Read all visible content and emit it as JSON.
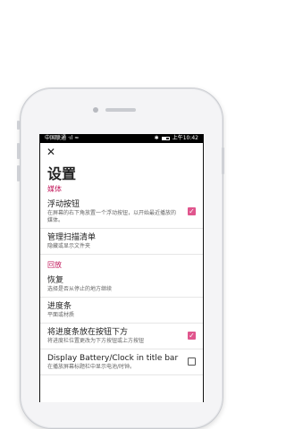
{
  "status_bar": {
    "carrier": "中国联通",
    "signal": "‧ıl",
    "wifi": "≈",
    "time": "上午10:42",
    "bt_icon": "bluetooth-icon"
  },
  "toolbar": {
    "close_glyph": "✕",
    "title": "设置"
  },
  "sections": {
    "media": "媒体",
    "resume": "回放"
  },
  "prefs": {
    "floating_button": {
      "title": "浮动按钮",
      "summary": "在屏幕的右下角放置一个浮动按钮，以开始最近播放的媒体。",
      "checked": true
    },
    "manage_scan": {
      "title": "管理扫描清单",
      "summary": "隐藏或显示文件夹"
    },
    "resume": {
      "title": "恢复",
      "summary": "选择是否从停止的地方继续"
    },
    "progress_bar": {
      "title": "进度条",
      "summary": "平面或材质"
    },
    "progress_below": {
      "title": "将进度条放在按钮下方",
      "summary": "将进度栏位置更改为下方按钮或上方按钮",
      "checked": true
    },
    "display_battery": {
      "title": "Display Battery/Clock in title bar",
      "summary": "在播放屏幕标题栏中显示电池/时钟。",
      "checked": false
    }
  },
  "colors": {
    "accent": "#e0558d",
    "section": "#c2185b"
  }
}
